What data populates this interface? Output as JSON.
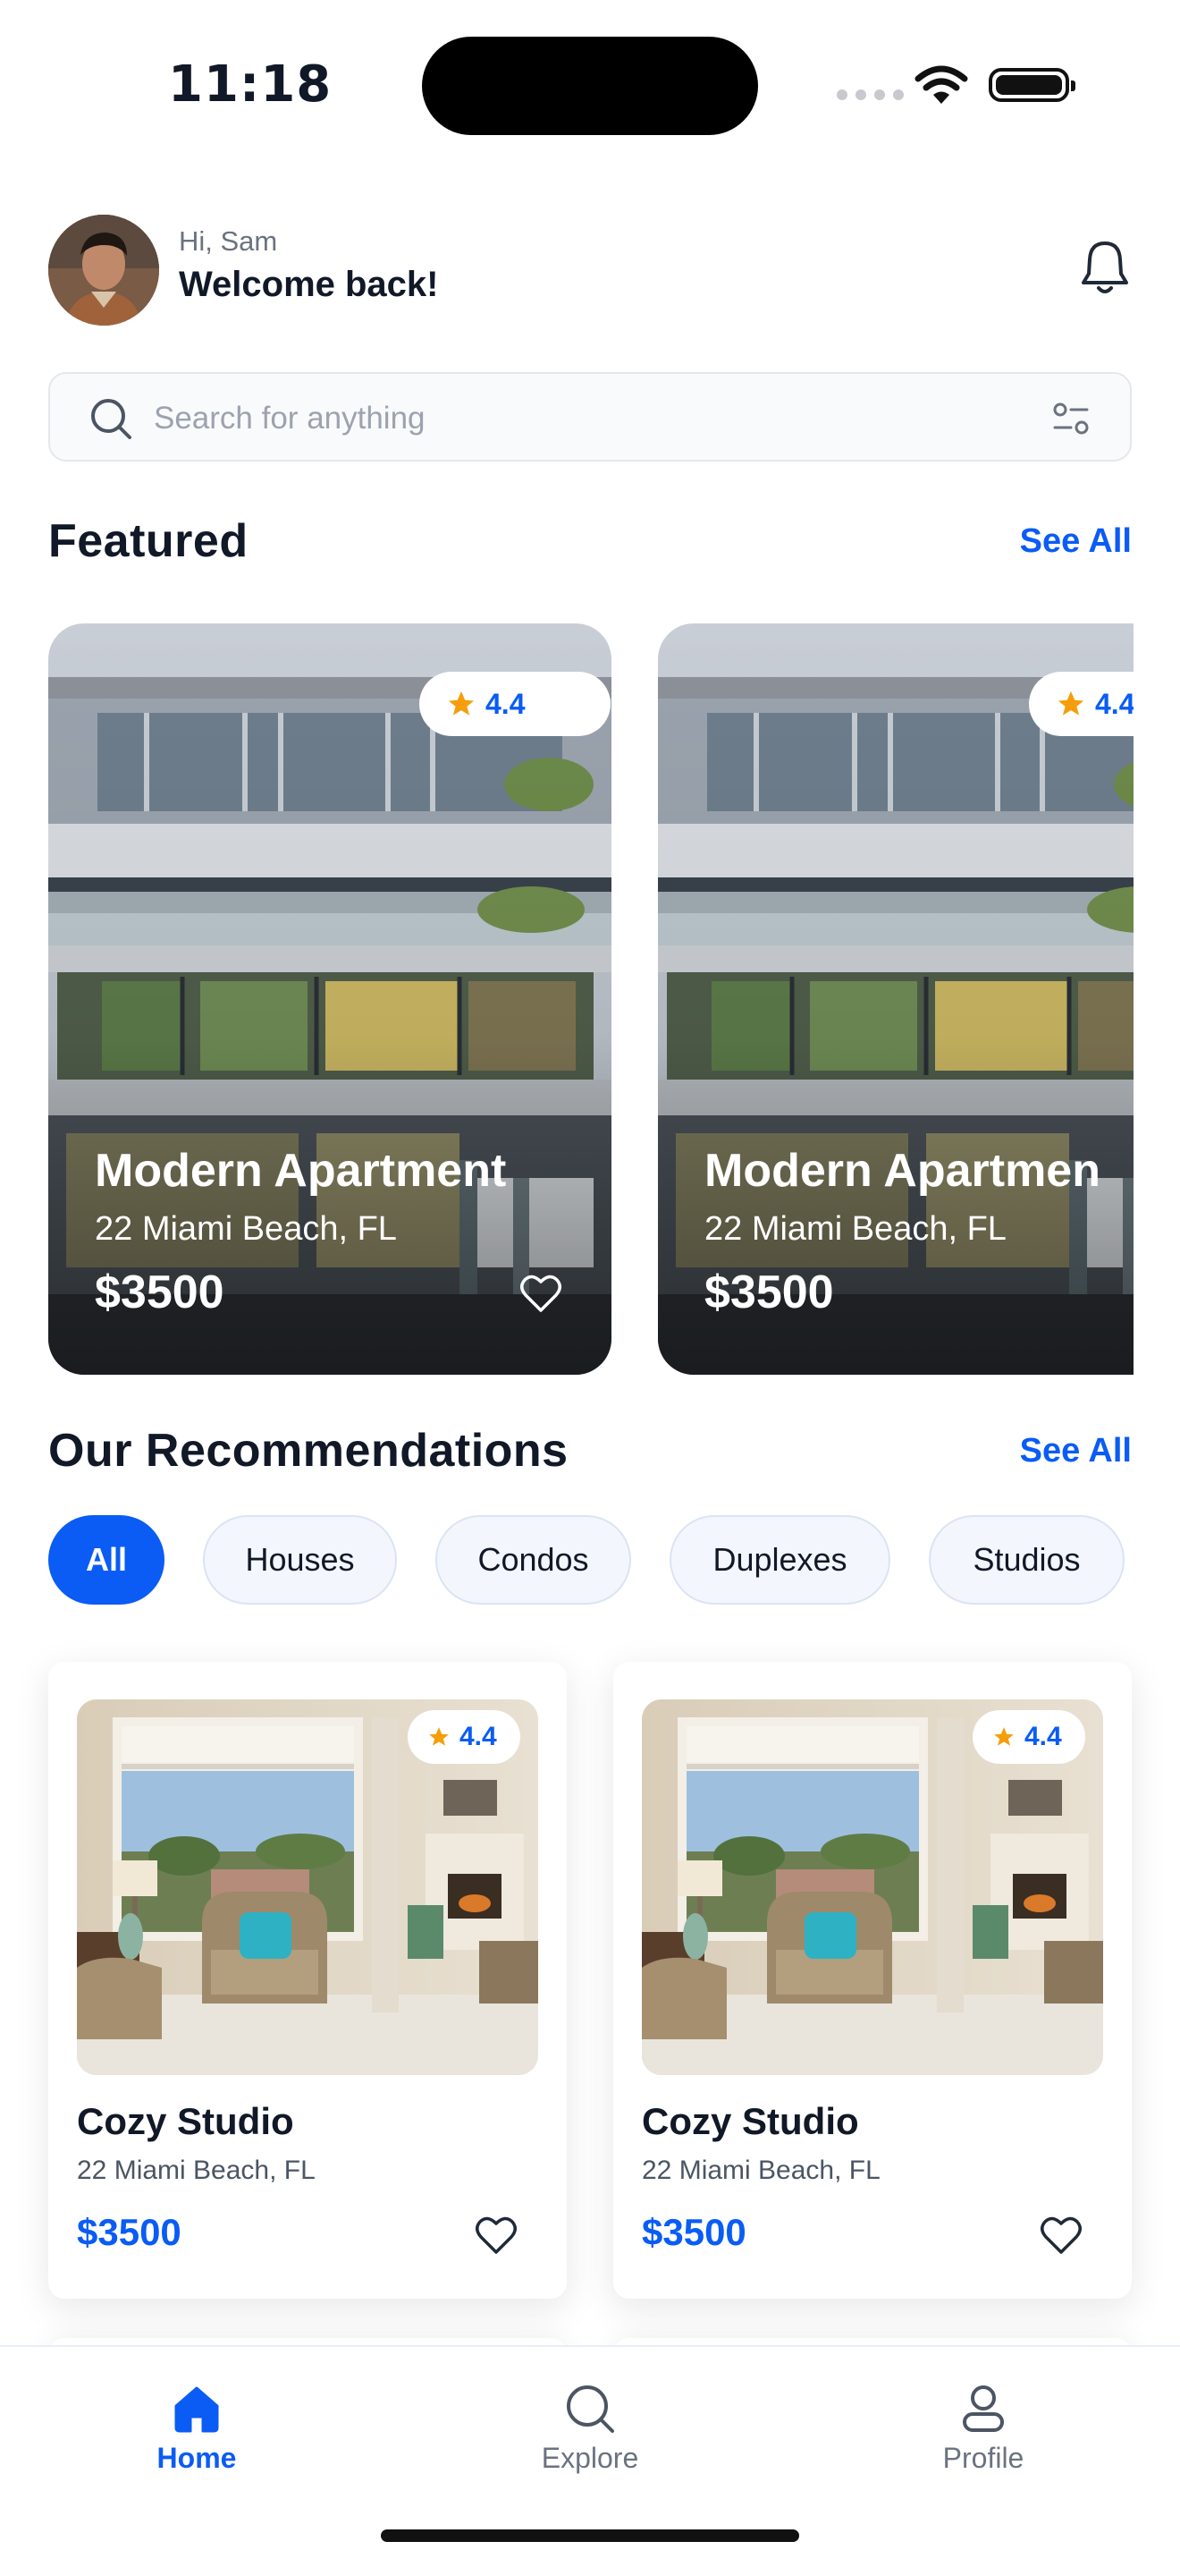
{
  "status_bar": {
    "time": "11:18"
  },
  "header": {
    "greeting": "Hi, Sam",
    "welcome": "Welcome back!"
  },
  "search": {
    "placeholder": "Search for anything"
  },
  "featured": {
    "title": "Featured",
    "see_all": "See All",
    "cards": [
      {
        "title": "Modern Apartment",
        "address": "22 Miami Beach, FL",
        "price": "$3500",
        "rating": "4.4"
      },
      {
        "title": "Modern Apartmen",
        "address": "22 Miami Beach, FL",
        "price": "$3500",
        "rating": "4.4"
      }
    ]
  },
  "recommendations": {
    "title": "Our Recommendations",
    "see_all": "See All",
    "filters": [
      "All",
      "Houses",
      "Condos",
      "Duplexes",
      "Studios"
    ],
    "active_filter": "All",
    "cards": [
      {
        "title": "Cozy Studio",
        "address": "22 Miami Beach, FL",
        "price": "$3500",
        "rating": "4.4"
      },
      {
        "title": "Cozy Studio",
        "address": "22 Miami Beach, FL",
        "price": "$3500",
        "rating": "4.4"
      }
    ]
  },
  "tabbar": {
    "items": [
      "Home",
      "Explore",
      "Profile"
    ],
    "active": "Home"
  },
  "colors": {
    "accent": "#0a5cf5",
    "star": "#f59e0b",
    "text": "#111827",
    "muted": "#6b7280"
  },
  "icons": [
    "bell-icon",
    "search-icon",
    "filter-icon",
    "star-icon",
    "heart-icon",
    "home-icon",
    "explore-icon",
    "profile-icon"
  ]
}
